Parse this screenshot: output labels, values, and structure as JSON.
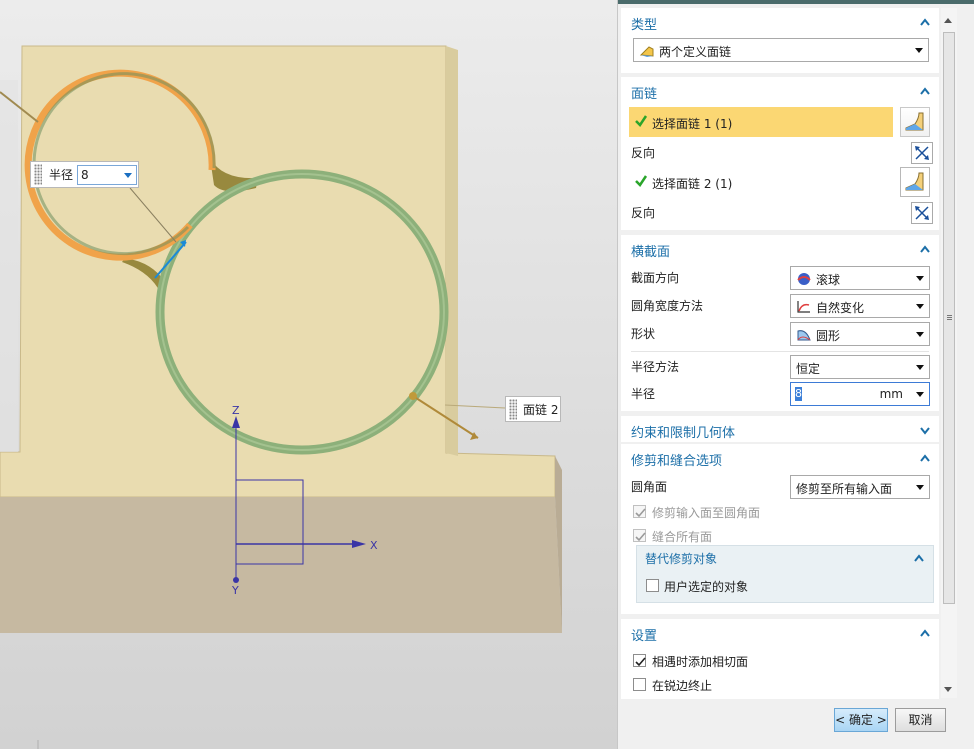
{
  "viewport": {
    "radius_callout": {
      "label": "半径",
      "value": "8"
    },
    "chain_callout": {
      "label": "面链 2"
    },
    "axes": {
      "x": "X",
      "y": "Y",
      "z": "Z"
    }
  },
  "dialog": {
    "type_group": {
      "title": "类型",
      "selected": "两个定义面链"
    },
    "chain_group": {
      "title": "面链",
      "select_chain_1": "选择面链 1 (1)",
      "reverse_1": "反向",
      "select_chain_2": "选择面链 2 (1)",
      "reverse_2": "反向"
    },
    "cross_section_group": {
      "title": "横截面",
      "section_dir_label": "截面方向",
      "section_dir_value": "滚球",
      "width_method_label": "圆角宽度方法",
      "width_method_value": "自然变化",
      "shape_label": "形状",
      "shape_value": "圆形",
      "radius_method_label": "半径方法",
      "radius_method_value": "恒定",
      "radius_label": "半径",
      "radius_value": "8",
      "radius_unit": "mm"
    },
    "constraint_group": {
      "title": "约束和限制几何体"
    },
    "trim_group": {
      "title": "修剪和缝合选项",
      "fillet_face_label": "圆角面",
      "fillet_face_value": "修剪至所有输入面",
      "trim_input_label": "修剪输入面至圆角面",
      "trim_input_checked": true,
      "sew_all_label": "缝合所有面",
      "sew_all_checked": true,
      "alt_trim": {
        "title": "替代修剪对象",
        "user_selected_label": "用户选定的对象",
        "user_selected_checked": false
      }
    },
    "settings_group": {
      "title": "设置",
      "add_tangent_label": "相遇时添加相切面",
      "add_tangent_checked": true,
      "stop_sharp_label": "在锐边终止",
      "stop_sharp_checked": false
    },
    "buttons": {
      "ok": "< 确定 >",
      "cancel": "取消"
    }
  },
  "colors": {
    "accent_title": "#1c6fa8",
    "selection_highlight": "#fbd773",
    "check_green": "#2aa52a",
    "part_body": "#e9dcb0",
    "chain1_orange": "#f0a34a",
    "chain2_green": "#8db07a"
  }
}
